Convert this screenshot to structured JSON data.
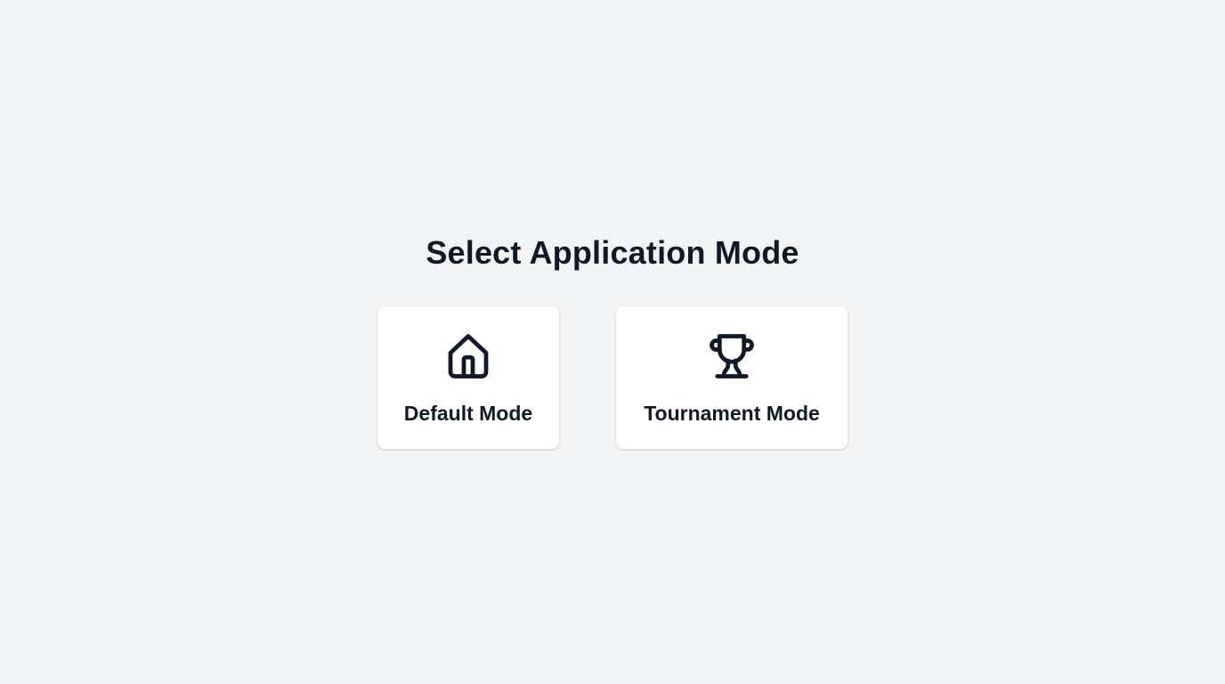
{
  "page": {
    "title": "Select Application Mode"
  },
  "modes": [
    {
      "label": "Default Mode",
      "icon": "home-icon"
    },
    {
      "label": "Tournament Mode",
      "icon": "trophy-icon"
    }
  ],
  "colors": {
    "background": "#f3f4f6",
    "card": "#ffffff",
    "text": "#111827"
  }
}
